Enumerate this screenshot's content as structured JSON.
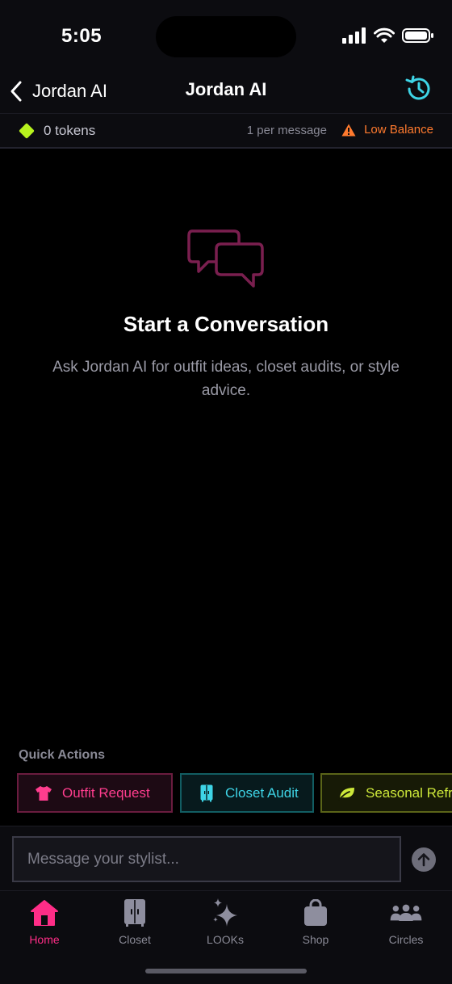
{
  "status_bar": {
    "time": "5:05"
  },
  "header": {
    "back_label": "Jordan AI",
    "title": "Jordan AI"
  },
  "token_bar": {
    "count": "0 tokens",
    "rate": "1 per message",
    "warning": "Low Balance"
  },
  "empty_state": {
    "title": "Start a Conversation",
    "description": "Ask Jordan AI for outfit ideas, closet audits, or style advice."
  },
  "quick_actions": {
    "label": "Quick Actions",
    "items": [
      {
        "label": "Outfit Request",
        "icon": "tshirt-icon"
      },
      {
        "label": "Closet Audit",
        "icon": "closet-icon"
      },
      {
        "label": "Seasonal Refresh",
        "icon": "leaf-icon"
      }
    ]
  },
  "composer": {
    "placeholder": "Message your stylist..."
  },
  "tabs": [
    {
      "label": "Home",
      "icon": "home-icon",
      "active": true
    },
    {
      "label": "Closet",
      "icon": "closet-icon",
      "active": false
    },
    {
      "label": "LOOKs",
      "icon": "sparkles-icon",
      "active": false
    },
    {
      "label": "Shop",
      "icon": "shopping-bag-icon",
      "active": false
    },
    {
      "label": "Circles",
      "icon": "people-icon",
      "active": false
    }
  ],
  "colors": {
    "accent_pink": "#ff2d87",
    "accent_cyan": "#3ed4e6",
    "accent_lime": "#cde83a",
    "warning_orange": "#ff7a2e",
    "token_green": "#b7f21e"
  }
}
